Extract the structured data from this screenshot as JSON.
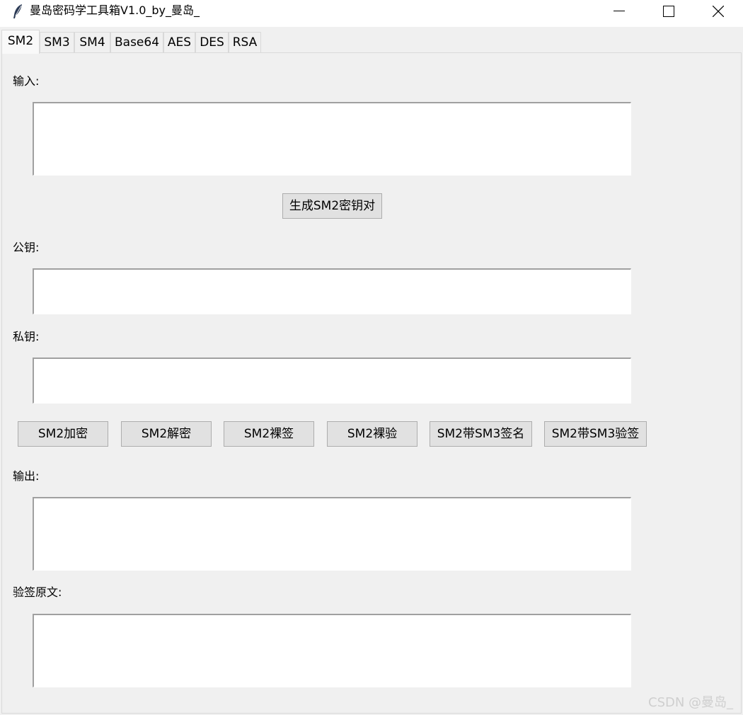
{
  "window": {
    "title": "曼岛密码学工具箱V1.0_by_曼岛_",
    "icon": "feather-icon"
  },
  "tabs": [
    "SM2",
    "SM3",
    "SM4",
    "Base64",
    "AES",
    "DES",
    "RSA"
  ],
  "active_tab": "SM2",
  "sm2": {
    "input_label": "输入:",
    "input_value": "",
    "gen_keypair_button": "生成SM2密钥对",
    "public_key_label": "公钥:",
    "public_key_value": "",
    "private_key_label": "私钥:",
    "private_key_value": "",
    "actions": [
      "SM2加密",
      "SM2解密",
      "SM2裸签",
      "SM2裸验",
      "SM2带SM3签名",
      "SM2带SM3验签"
    ],
    "output_label": "输出:",
    "output_value": "",
    "verify_text_label": "验签原文:",
    "verify_text_value": ""
  },
  "watermark": "CSDN @曼岛_",
  "colors": {
    "window_bg": "#f0f0f0",
    "button_bg": "#e1e1e1",
    "button_border": "#adadad",
    "textbox_bg": "#ffffff"
  }
}
